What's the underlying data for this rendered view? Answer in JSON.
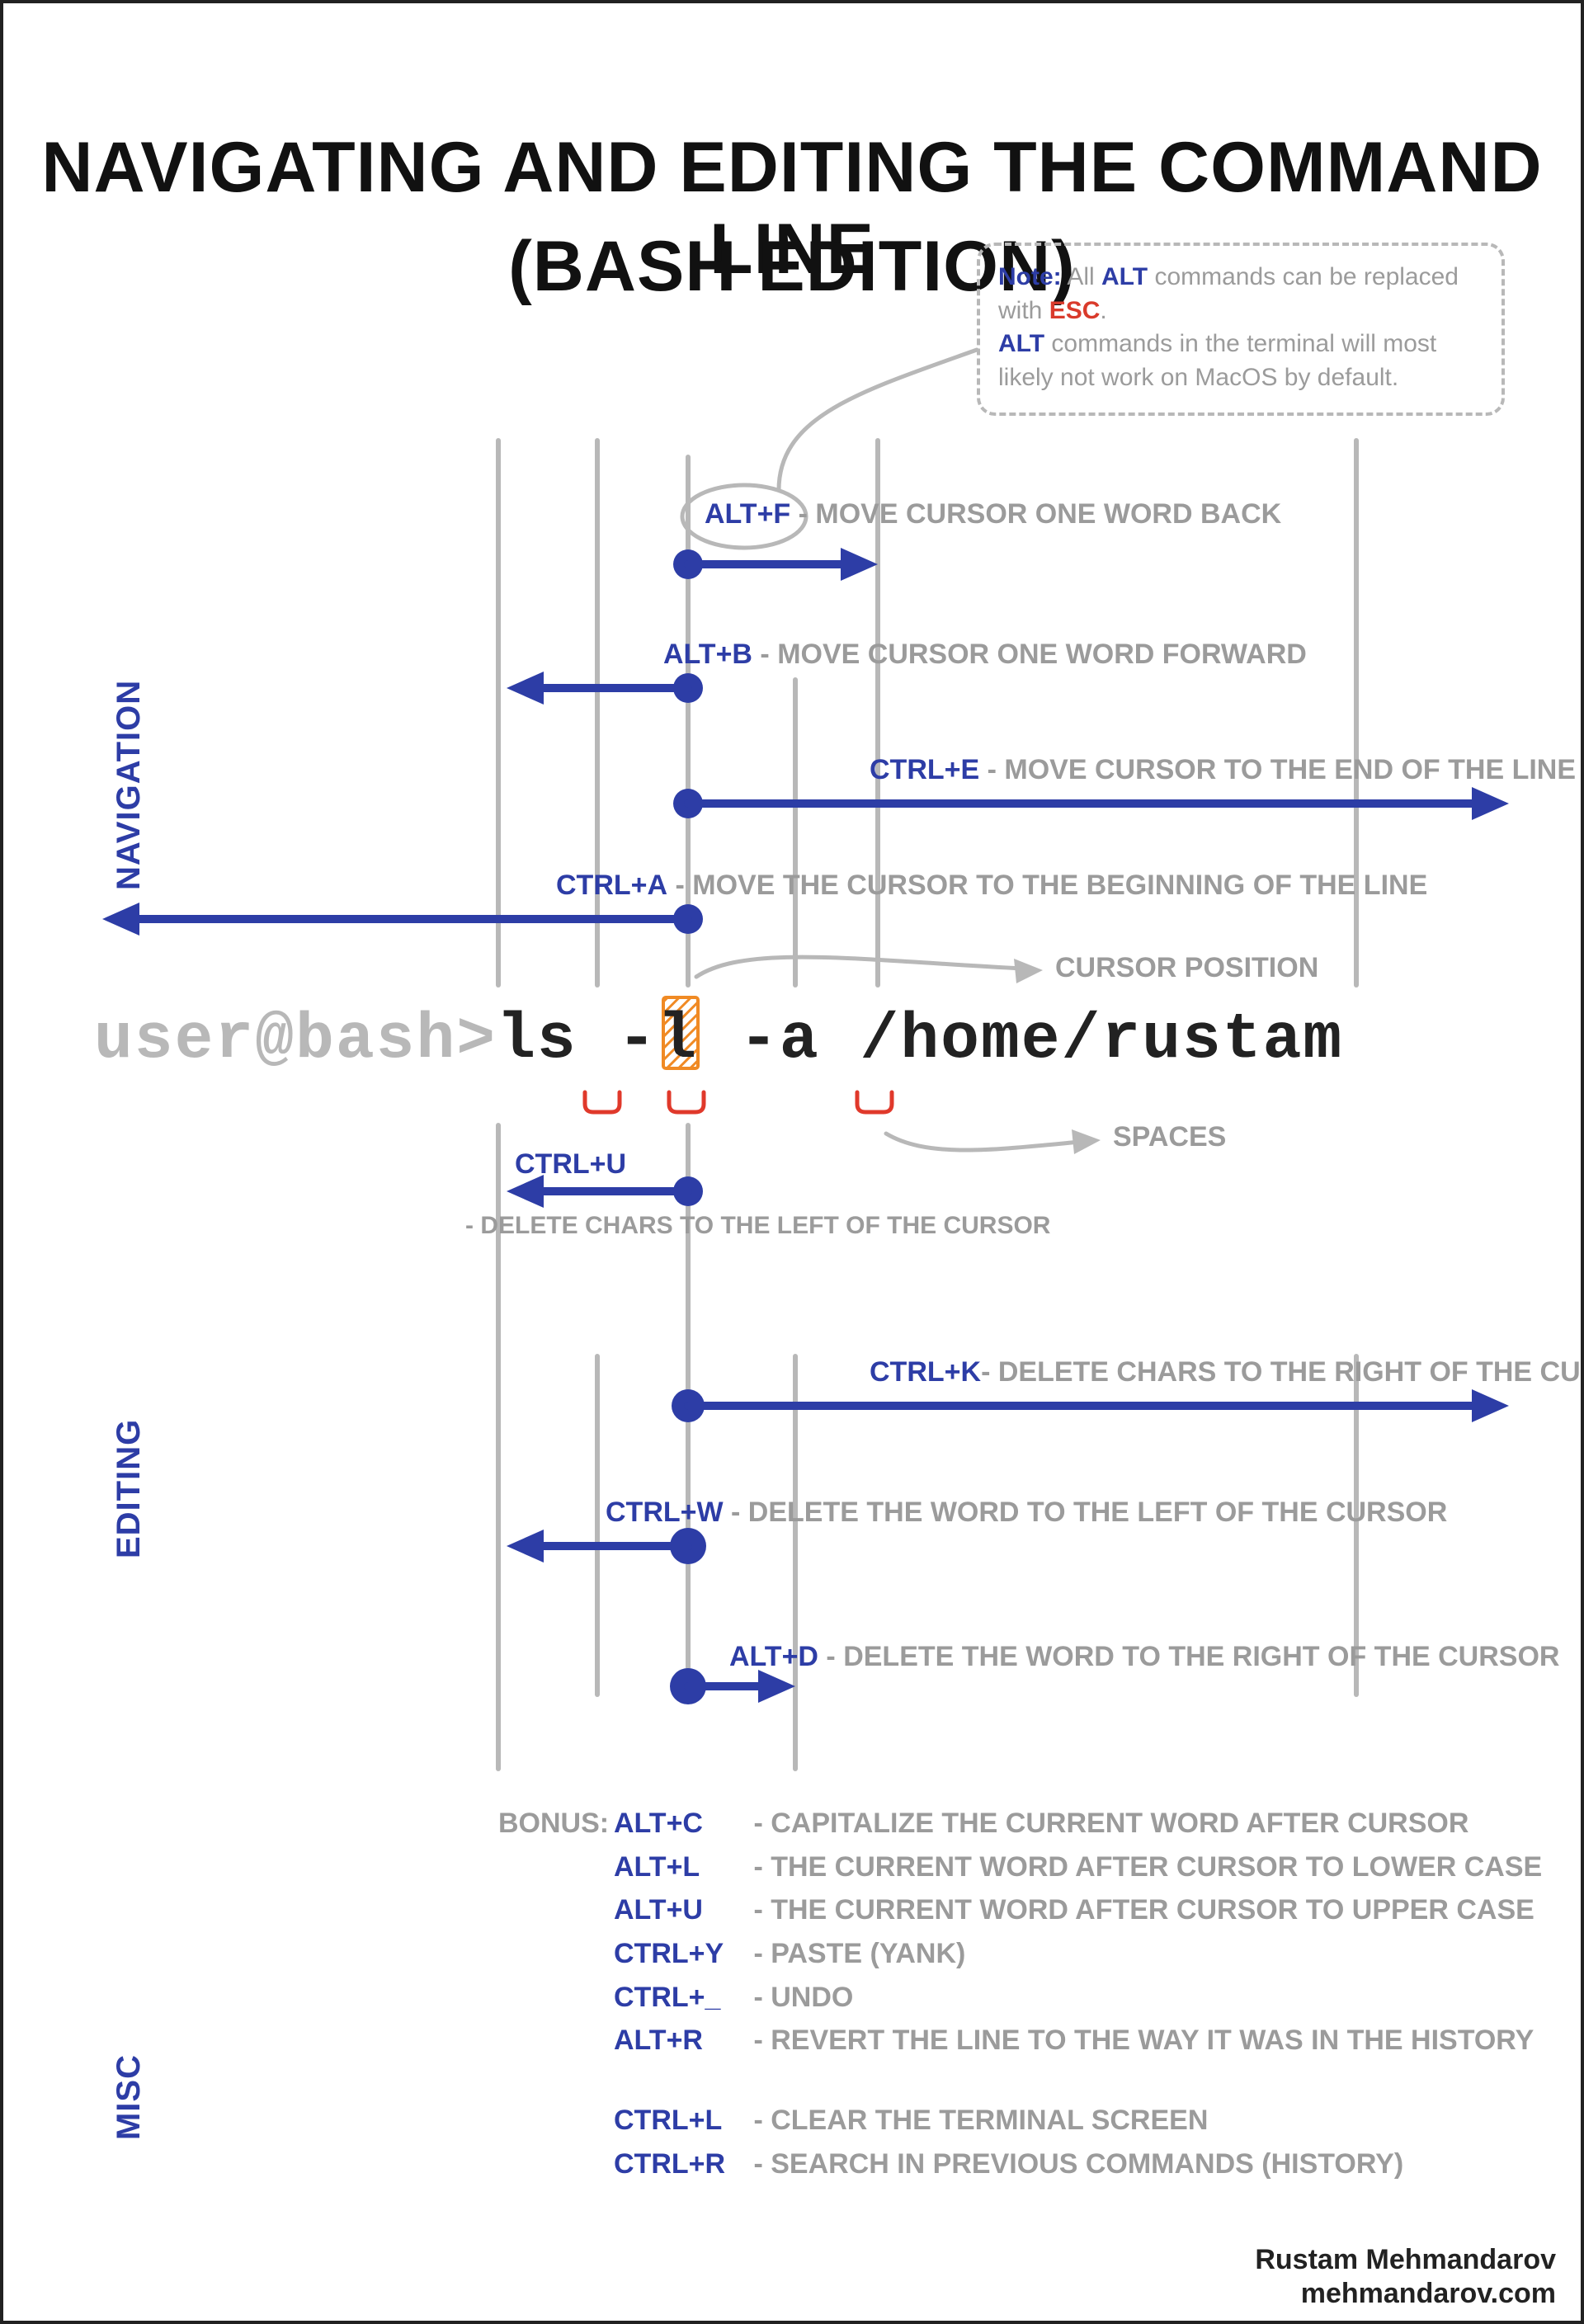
{
  "title_line1": "NAVIGATING AND EDITING THE COMMAND LINE",
  "title_line2": "(BASH EDITION)",
  "note": {
    "label_note": "Note:",
    "t1": " All ",
    "alt1": "ALT",
    "t2": " commands can be replaced with ",
    "esc": "ESC",
    "t3": ".",
    "alt2": "ALT",
    "t4": " commands in the terminal will most likely not work on MacOS by default."
  },
  "sections": {
    "navigation": "NAVIGATION",
    "editing": "EDITING",
    "misc": "MISC"
  },
  "cmd_parts": [
    {
      "text": "user@bash>",
      "cls": "prompt"
    },
    {
      "text": "ls -l",
      "cls": "text"
    },
    {
      "text": "-a /home/rustam",
      "cls": "text"
    }
  ],
  "annotations": {
    "cursor_position": "CURSOR POSITION",
    "spaces": "SPACES"
  },
  "nav": [
    {
      "key": "ALT+F",
      "desc": " - MOVE CURSOR ONE WORD BACK"
    },
    {
      "key": "ALT+B",
      "desc": " - MOVE CURSOR ONE WORD FORWARD"
    },
    {
      "key": "CTRL+E",
      "desc": " - MOVE CURSOR TO THE END OF THE LINE"
    },
    {
      "key": "CTRL+A",
      "desc": " - MOVE THE CURSOR TO THE BEGINNING OF THE LINE"
    }
  ],
  "edit": [
    {
      "key": "CTRL+U",
      "desc": " - DELETE CHARS TO THE LEFT OF THE CURSOR"
    },
    {
      "key": "CTRL+K",
      "desc": "- DELETE CHARS TO THE RIGHT OF THE CURSOR"
    },
    {
      "key": "CTRL+W",
      "desc": " - DELETE THE WORD TO THE LEFT OF THE CURSOR"
    },
    {
      "key": "ALT+D",
      "desc": " - DELETE THE WORD TO THE RIGHT OF THE CURSOR"
    }
  ],
  "bonus_label": "BONUS:",
  "bonus": [
    {
      "key": "ALT+C",
      "desc": "- CAPITALIZE THE CURRENT WORD AFTER CURSOR"
    },
    {
      "key": "ALT+L",
      "desc": "- THE CURRENT WORD AFTER CURSOR TO LOWER CASE"
    },
    {
      "key": "ALT+U",
      "desc": "- THE CURRENT WORD AFTER CURSOR TO UPPER CASE"
    },
    {
      "key": "CTRL+Y",
      "desc": "- PASTE (YANK)"
    },
    {
      "key": "CTRL+_",
      "desc": "- UNDO"
    },
    {
      "key": "ALT+R",
      "desc": "- REVERT THE LINE TO THE WAY IT WAS IN THE HISTORY"
    }
  ],
  "misc": [
    {
      "key": "CTRL+L",
      "desc": "- CLEAR THE TERMINAL SCREEN"
    },
    {
      "key": "CTRL+R",
      "desc": "- SEARCH IN PREVIOUS COMMANDS (HISTORY)"
    }
  ],
  "credits": {
    "author": "Rustam Mehmandarov",
    "site": "mehmandarov.com"
  }
}
